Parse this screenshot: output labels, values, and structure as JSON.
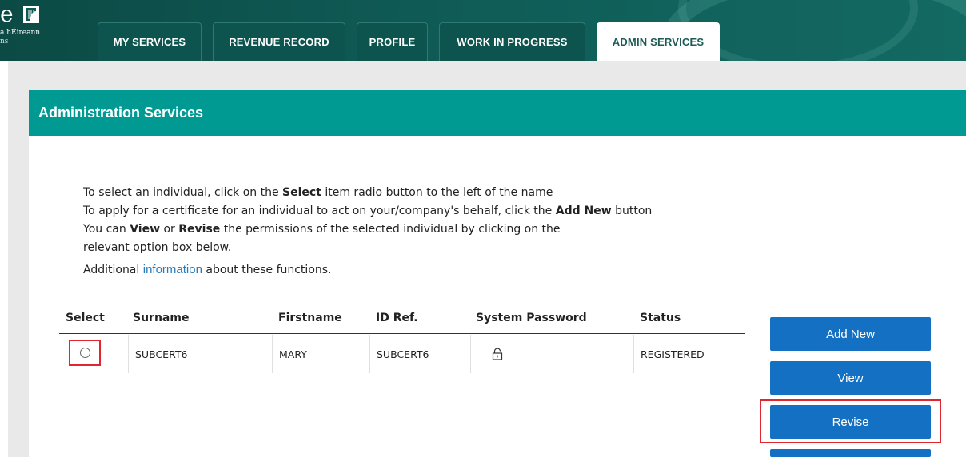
{
  "header": {
    "logo_text": "e",
    "logo_line1": "a hÉireann",
    "logo_line2": "ns",
    "tabs": [
      {
        "label": "MY SERVICES",
        "active": false
      },
      {
        "label": "REVENUE RECORD",
        "active": false
      },
      {
        "label": "PROFILE",
        "active": false
      },
      {
        "label": "WORK IN PROGRESS",
        "active": false
      },
      {
        "label": "ADMIN SERVICES",
        "active": true
      }
    ]
  },
  "panel": {
    "title": "Administration Services"
  },
  "instructions": {
    "line1_a": "To select an individual, click on the ",
    "line1_b": "Select",
    "line1_c": " item radio button to the left of the name",
    "line2_a": "To apply for a certificate for an individual to act on your/company's behalf, click the ",
    "line2_b": "Add New",
    "line2_c": " button",
    "line3_a": "You can ",
    "line3_b": "View",
    "line3_c": " or ",
    "line3_d": "Revise",
    "line3_e": " the permissions of the selected individual by clicking on the",
    "line4": "relevant option box below.",
    "extra_a": "Additional ",
    "extra_link": "information",
    "extra_b": " about these functions."
  },
  "table": {
    "headers": [
      "Select",
      "Surname",
      "Firstname",
      "ID Ref.",
      "System Password",
      "Status"
    ],
    "rows": [
      {
        "surname": "SUBCERT6",
        "firstname": "MARY",
        "id_ref": "SUBCERT6",
        "status": "REGISTERED"
      }
    ]
  },
  "actions": {
    "add_new": "Add New",
    "view": "View",
    "revise": "Revise"
  },
  "colors": {
    "header_bg": "#0f5954",
    "panel_head": "#009a93",
    "button": "#1470c2",
    "highlight": "#e0262f",
    "link": "#2a7ab8"
  }
}
